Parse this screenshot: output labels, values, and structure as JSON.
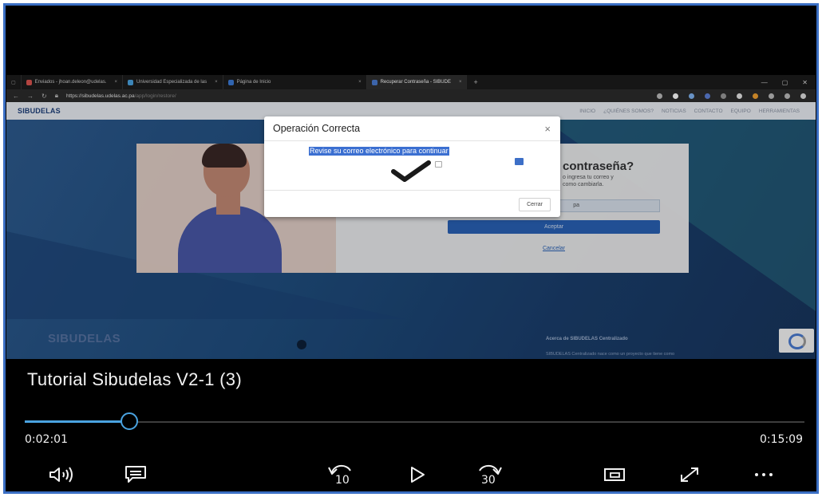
{
  "browser": {
    "tabs": [
      {
        "label": "Enviados - jhoan.deleon@udelas.",
        "color": "#d9534f"
      },
      {
        "label": "Universidad Especializada de las",
        "color": "#4aa3e0"
      },
      {
        "label": "Página de Inicio",
        "color": "#3b7bd6"
      },
      {
        "label": "Recuperar Contraseña - SIBUDE",
        "color": "#4a7bd0"
      }
    ],
    "url": "https://sibudelas.udelas.ac.pa",
    "url_path": "/app/login/restore/"
  },
  "site": {
    "logo": "SIBUDELAS",
    "nav": [
      "INICIO",
      "¿QUIÉNES SOMOS?",
      "NOTICIAS",
      "CONTACTO",
      "EQUIPO",
      "HERRAMIENTAS"
    ],
    "form": {
      "title": "contraseña?",
      "desc_line1": "o ingresa tu correo y",
      "desc_line2": "como cambiarla.",
      "email_value": "pa",
      "accept_label": "Aceptar",
      "cancel_label": "Cancelar"
    },
    "footer": {
      "logo": "SIBUDELAS",
      "about_title": "Acerca de SIBUDELAS Centralizado",
      "about_text": "SIBUDELAS Centralizado nace como un proyecto que tiene como"
    }
  },
  "modal": {
    "title": "Operación Correcta",
    "close": "×",
    "message": "Revise su correo electrónico para continuar",
    "button_label": "Cerrar"
  },
  "player": {
    "title": "Tutorial Sibudelas V2-1 (3)",
    "current_time": "0:02:01",
    "total_time": "0:15:09",
    "progress": 0.134,
    "seek_back": "10",
    "seek_forward": "30",
    "accent": "#4aa3e0"
  }
}
